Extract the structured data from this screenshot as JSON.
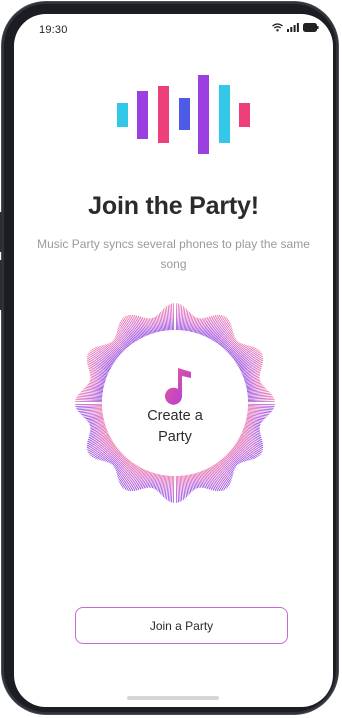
{
  "status_bar": {
    "time": "19:30",
    "icons": [
      "wifi-icon",
      "signal-icon",
      "battery-icon"
    ]
  },
  "logo": {
    "icon": "audio-wave-icon",
    "colors": [
      "#34c8e8",
      "#9b3fe0",
      "#ef3f7a",
      "#4c5ce6",
      "#9b3fe0",
      "#34c8e8",
      "#ef3f7a"
    ]
  },
  "main": {
    "title": "Join the Party!",
    "subtitle": "Music Party syncs several phones to play the same song",
    "create_party": {
      "label_line1": "Create a",
      "label_line2": "Party",
      "icon": "music-note-icon"
    },
    "join_button": {
      "label": "Join a Party"
    }
  },
  "colors": {
    "accent_pink": "#e9478a",
    "accent_purple": "#9a3ee0",
    "button_border": "#c66ad6",
    "title": "#2b2b2b",
    "subtitle": "#9a9a9a"
  }
}
